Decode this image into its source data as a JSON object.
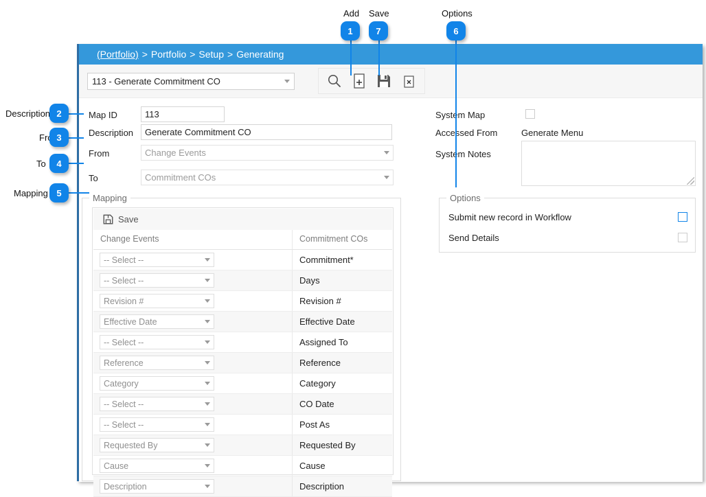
{
  "callouts": [
    {
      "n": "1",
      "label": "Add",
      "label_pos": "top"
    },
    {
      "n": "7",
      "label": "Save",
      "label_pos": "top"
    },
    {
      "n": "6",
      "label": "Options",
      "label_pos": "top"
    },
    {
      "n": "2",
      "label": "Description",
      "label_pos": "left"
    },
    {
      "n": "3",
      "label": "From",
      "label_pos": "left"
    },
    {
      "n": "4",
      "label": "To",
      "label_pos": "left"
    },
    {
      "n": "5",
      "label": "Mapping",
      "label_pos": "left"
    }
  ],
  "titlebar": {
    "crumb_first": "(Portfolio)",
    "crumb_rest": [
      "Portfolio",
      "Setup",
      "Generating"
    ],
    "separator": ">"
  },
  "toolbar": {
    "map_selector_value": "113 - Generate Commitment CO",
    "icons": [
      {
        "name": "search-icon",
        "title": "Search"
      },
      {
        "name": "add-icon",
        "title": "Add"
      },
      {
        "name": "save-icon",
        "title": "Save"
      },
      {
        "name": "delete-icon",
        "title": "Delete"
      }
    ]
  },
  "form": {
    "map_id_label": "Map ID",
    "map_id_value": "113",
    "description_label": "Description",
    "description_value": "Generate Commitment CO",
    "from_label": "From",
    "from_value": "Change Events",
    "to_label": "To",
    "to_value": "Commitment COs",
    "system_map_label": "System Map",
    "system_map_checked": false,
    "accessed_from_label": "Accessed From",
    "accessed_from_value": "Generate Menu",
    "system_notes_label": "System Notes",
    "system_notes_value": ""
  },
  "options_group": {
    "title": "Options",
    "items": [
      {
        "label": "Submit new record in Workflow",
        "checked": false,
        "enabled": true
      },
      {
        "label": "Send Details",
        "checked": false,
        "enabled": false
      }
    ]
  },
  "mapping_group": {
    "title": "Mapping",
    "save_label": "Save",
    "columns": [
      "Change Events",
      "Commitment COs"
    ],
    "rows": [
      {
        "source": "-- Select --",
        "target": "Commitment*"
      },
      {
        "source": "-- Select --",
        "target": "Days"
      },
      {
        "source": "Revision #",
        "target": "Revision #"
      },
      {
        "source": "Effective Date",
        "target": "Effective Date"
      },
      {
        "source": "-- Select --",
        "target": "Assigned To"
      },
      {
        "source": "Reference",
        "target": "Reference"
      },
      {
        "source": "Category",
        "target": "Category"
      },
      {
        "source": "-- Select --",
        "target": "CO Date"
      },
      {
        "source": "-- Select --",
        "target": "Post As"
      },
      {
        "source": "Requested By",
        "target": "Requested By"
      },
      {
        "source": "Cause",
        "target": "Cause"
      },
      {
        "source": "Description",
        "target": "Description"
      }
    ]
  },
  "colors": {
    "accent": "#1184e8",
    "titlebar": "#3498db",
    "panel_border": "#2e6da4"
  }
}
